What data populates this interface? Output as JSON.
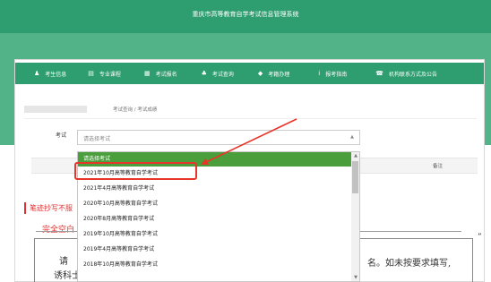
{
  "header": {
    "title": "重庆市高等教育自学考试信息管理系统"
  },
  "nav": {
    "items": [
      {
        "label": "考生信息",
        "icon": "user-icon",
        "glyph": "♟"
      },
      {
        "label": "专业课程",
        "icon": "id-card-icon",
        "glyph": "▤"
      },
      {
        "label": "考试报名",
        "icon": "form-icon",
        "glyph": "▦"
      },
      {
        "label": "考试查询",
        "icon": "sitemap-icon",
        "glyph": "♣"
      },
      {
        "label": "考籍办理",
        "icon": "tag-icon",
        "glyph": "◆"
      },
      {
        "label": "报考指南",
        "icon": "info-icon",
        "glyph": "i"
      },
      {
        "label": "机构联系方式及公告",
        "icon": "phone-icon",
        "glyph": "☎"
      }
    ]
  },
  "breadcrumb": {
    "text": "考试查询 / 考试成绩"
  },
  "form": {
    "exam_label": "考试",
    "exam_placeholder": "请选择考试"
  },
  "table": {
    "remark_header": "备注"
  },
  "dropdown": {
    "options": [
      "请选择考试",
      "2021年10月高等教育自学考试",
      "2021年4月高等教育自学考试",
      "2020年10月高等教育自学考试",
      "2020年8月高等教育自学考试",
      "2019年10月高等教育自学考试",
      "2019年4月高等教育自学考试",
      "2018年10月高等教育自学考试"
    ],
    "active_index": 0
  },
  "notice": {
    "red_heading": "笔迹抄写不服",
    "inner_heading": "完全空白",
    "fragment_l1": "请",
    "fragment_l2": "诱科士",
    "fragment_right": "名。如未按要求填写,",
    "edge_char": "”"
  },
  "colors": {
    "header": "#2e9d6f",
    "band": "#52b389",
    "option_active": "#4a9f3c",
    "annotation": "#e8352a"
  }
}
